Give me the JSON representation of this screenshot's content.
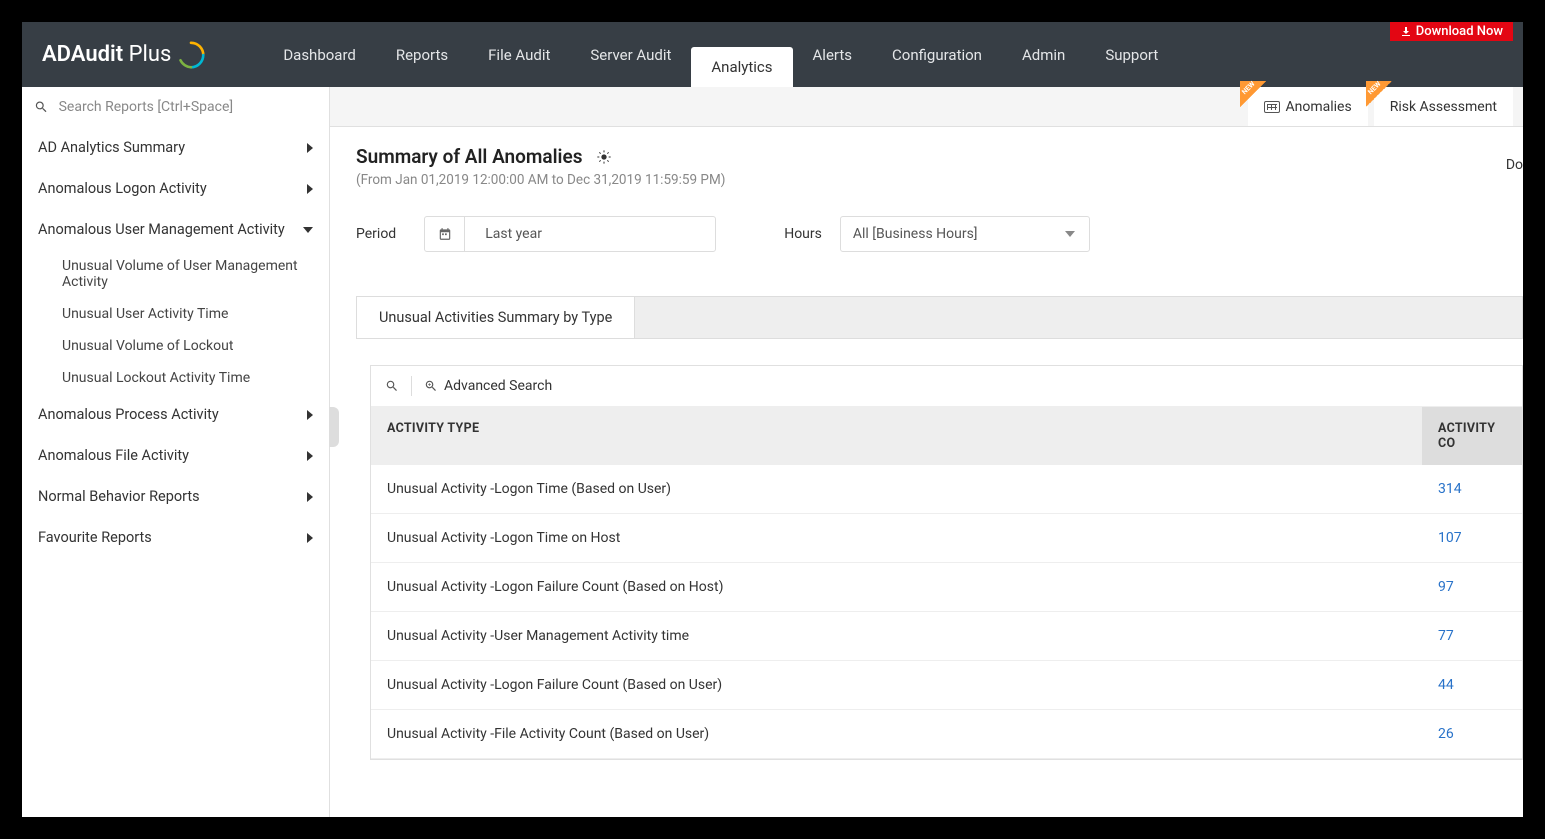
{
  "download_label": "Download Now",
  "logo": {
    "main": "ADAudit",
    "suffix": "Plus"
  },
  "nav": [
    "Dashboard",
    "Reports",
    "File Audit",
    "Server Audit",
    "Analytics",
    "Alerts",
    "Configuration",
    "Admin",
    "Support"
  ],
  "nav_active_index": 4,
  "search_placeholder": "Search Reports [Ctrl+Space]",
  "subtabs": {
    "anomalies": "Anomalies",
    "risk": "Risk Assessment"
  },
  "new_badge": "NEW",
  "sidebar": {
    "items": [
      {
        "label": "AD Analytics Summary",
        "expanded": false
      },
      {
        "label": "Anomalous Logon Activity",
        "expanded": false
      },
      {
        "label": "Anomalous User Management Activity",
        "expanded": true,
        "children": [
          "Unusual Volume of User Management Activity",
          "Unusual User Activity Time",
          "Unusual Volume of Lockout",
          "Unusual Lockout Activity Time"
        ]
      },
      {
        "label": "Anomalous Process Activity",
        "expanded": false
      },
      {
        "label": "Anomalous File Activity",
        "expanded": false
      },
      {
        "label": "Normal Behavior Reports",
        "expanded": false
      },
      {
        "label": "Favourite Reports",
        "expanded": false
      }
    ]
  },
  "page_title": "Summary of All Anomalies",
  "date_range": "(From Jan 01,2019 12:00:00 AM to Dec 31,2019 11:59:59 PM)",
  "do_label": "Do",
  "filters": {
    "period_label": "Period",
    "period_value": "Last year",
    "hours_label": "Hours",
    "hours_value": "All [Business Hours]"
  },
  "tab_label": "Unusual Activities Summary by Type",
  "advanced_search": "Advanced Search",
  "table": {
    "headers": {
      "type": "ACTIVITY TYPE",
      "count": "ACTIVITY CO"
    },
    "rows": [
      {
        "type": "Unusual Activity -Logon Time (Based on User)",
        "count": "314"
      },
      {
        "type": "Unusual Activity -Logon Time on Host",
        "count": "107"
      },
      {
        "type": "Unusual Activity -Logon Failure Count (Based on Host)",
        "count": "97"
      },
      {
        "type": "Unusual Activity -User Management Activity time",
        "count": "77"
      },
      {
        "type": "Unusual Activity -Logon Failure Count (Based on User)",
        "count": "44"
      },
      {
        "type": "Unusual Activity -File Activity Count (Based on User)",
        "count": "26"
      }
    ]
  }
}
